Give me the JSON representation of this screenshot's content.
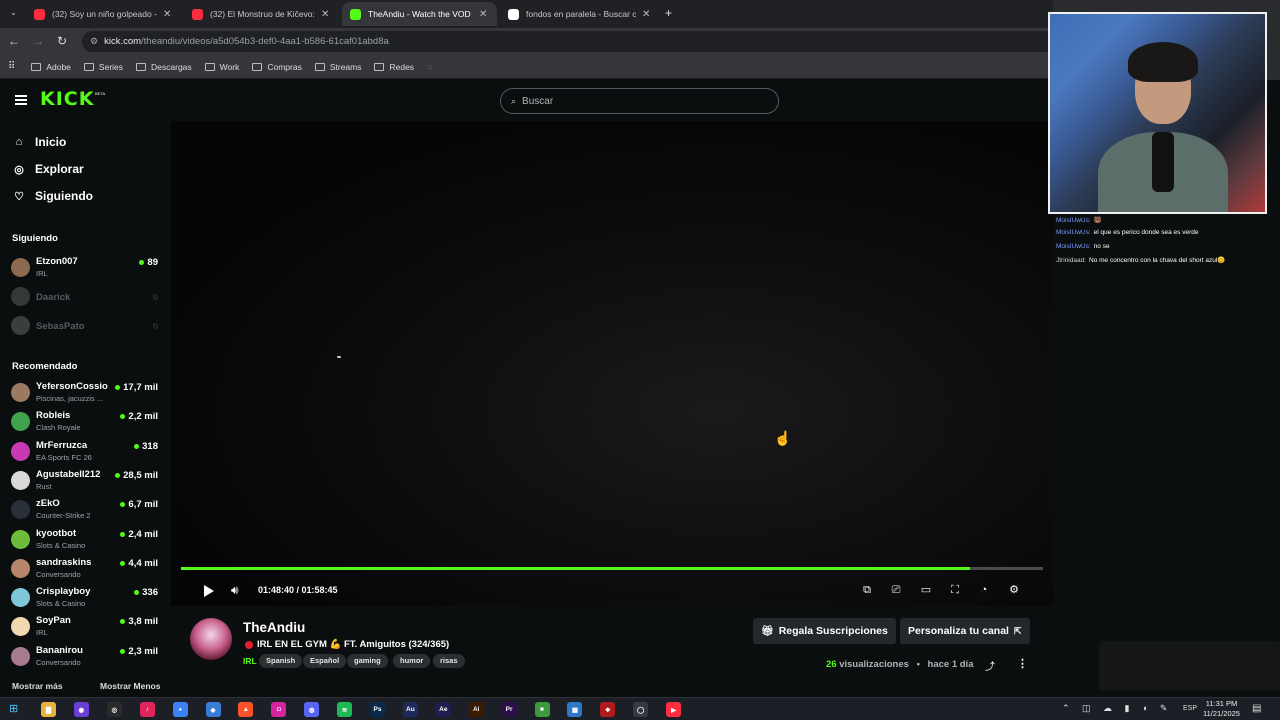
{
  "browser": {
    "tabs": [
      {
        "title": "(32) Soy un niño golpeado - Yo",
        "icon_color": "#ff2d3d",
        "active": false
      },
      {
        "title": "(32) El Monstruo de Kičevo: un",
        "icon_color": "#ff2d3d",
        "active": false
      },
      {
        "title": "TheAndiu - Watch the VOD on",
        "icon_color": "#53fc18",
        "active": true
      },
      {
        "title": "fondos en paralela - Buscar con",
        "icon_color": "#ffffff",
        "active": false
      }
    ],
    "new_tab": "+",
    "url_host": "kick.com",
    "url_path": "/theandiu/videos/a5d054b3-def0-4aa1-b586-61caf01abd8a",
    "bookmarks": [
      "Adobe",
      "Series",
      "Descargas",
      "Work",
      "Compras",
      "Streams",
      "Redes"
    ]
  },
  "kick": {
    "logo": "KICK",
    "logo_badge": "BETA",
    "search_placeholder": "Buscar"
  },
  "sidebar": {
    "nav": [
      {
        "label": "Inicio",
        "icon": "home-icon",
        "glyph": "⌂"
      },
      {
        "label": "Explorar",
        "icon": "compass-icon",
        "glyph": "◎"
      },
      {
        "label": "Siguiendo",
        "icon": "heart-icon",
        "glyph": "♡"
      }
    ],
    "following_title": "Siguiendo",
    "following": [
      {
        "name": "Etzon007",
        "sub": "IRL",
        "viewers": "89",
        "live": true,
        "color": "#8b6a4f"
      },
      {
        "name": "Daarick",
        "sub": "",
        "viewers": "",
        "live": false,
        "color": "#888"
      },
      {
        "name": "SebasPato",
        "sub": "",
        "viewers": "",
        "live": false,
        "color": "#999"
      }
    ],
    "recommended_title": "Recomendado",
    "recommended": [
      {
        "name": "YefersonCossio",
        "sub": "Piscinas, jacuzzis ...",
        "viewers": "17,7 mil",
        "color": "#9c7a62"
      },
      {
        "name": "Robleis",
        "sub": "Clash Royale",
        "viewers": "2,2 mil",
        "color": "#3fa34d"
      },
      {
        "name": "MrFerruzca",
        "sub": "EA Sports FC 26",
        "viewers": "318",
        "color": "#c83ab3"
      },
      {
        "name": "Agustabell212",
        "sub": "Rust",
        "viewers": "28,5 mil",
        "color": "#d9d9d9"
      },
      {
        "name": "zEkO",
        "sub": "Counter-Strike 2",
        "viewers": "6,7 mil",
        "color": "#2a3038"
      },
      {
        "name": "kyootbot",
        "sub": "Slots & Casino",
        "viewers": "2,4 mil",
        "color": "#6dbd3a"
      },
      {
        "name": "sandraskins",
        "sub": "Conversando",
        "viewers": "4,4 mil",
        "color": "#b7866a"
      },
      {
        "name": "Crisplayboy",
        "sub": "Slots & Casino",
        "viewers": "336",
        "color": "#7fc7d9"
      },
      {
        "name": "SoyPan",
        "sub": "IRL",
        "viewers": "3,8 mil",
        "color": "#f2d8b0"
      },
      {
        "name": "Bananirou",
        "sub": "Conversando",
        "viewers": "2,3 mil",
        "color": "#a77a8e"
      }
    ],
    "show_more": "Mostrar más",
    "show_less": "Mostrar Menos"
  },
  "player": {
    "progress": 0.915,
    "time": "01:48:40 / 01:58:45"
  },
  "stream": {
    "channel": "TheAndiu",
    "title": "IRL EN EL GYM 💪 FT. Amiguitos (324/365)",
    "category": "IRL",
    "tags": [
      "Spanish",
      "Español",
      "gaming",
      "humor",
      "risas"
    ],
    "gift_button": "Regala Suscripciones",
    "customize_button": "Personaliza tu canal",
    "views_count": "26",
    "views_label": "visualizaciones",
    "separator": "•",
    "age": "hace 1 día"
  },
  "chat": [
    {
      "user": "MoisIUwUs:",
      "text": "🐻",
      "user_style": "blue"
    },
    {
      "user": "MoisIUwUs:",
      "text": "el que es perico donde sea es verde",
      "user_style": "blue"
    },
    {
      "user": "MoisIUwUs:",
      "text": "no se",
      "user_style": "blue"
    },
    {
      "user": "Jtrinidaad:",
      "text": "No me concentro con la chava del short azul😊",
      "user_style": "gray"
    }
  ],
  "taskbar": {
    "apps": [
      {
        "name": "file-explorer",
        "label": "▇",
        "bg": "#e7b33c"
      },
      {
        "name": "app-purple",
        "label": "◉",
        "bg": "#6a3fd6"
      },
      {
        "name": "app-red-ring",
        "label": "◎",
        "bg": "#2b2b2b"
      },
      {
        "name": "tiktok",
        "label": "♪",
        "bg": "#e0245e"
      },
      {
        "name": "chrome",
        "label": "◕",
        "bg": "#3b82f6"
      },
      {
        "name": "app-cube",
        "label": "◆",
        "bg": "#3a7bd5"
      },
      {
        "name": "brave",
        "label": "▲",
        "bg": "#fb542b"
      },
      {
        "name": "instagram",
        "label": "◘",
        "bg": "#d6249f"
      },
      {
        "name": "discord",
        "label": "◍",
        "bg": "#5865f2"
      },
      {
        "name": "spotify",
        "label": "≋",
        "bg": "#1db954"
      },
      {
        "name": "photoshop",
        "label": "Ps",
        "bg": "#0b2a4a"
      },
      {
        "name": "audition",
        "label": "Au",
        "bg": "#1f2a5c"
      },
      {
        "name": "after-effects",
        "label": "Ae",
        "bg": "#1f1f4d"
      },
      {
        "name": "illustrator",
        "label": "Ai",
        "bg": "#3a1b00"
      },
      {
        "name": "premiere",
        "label": "Pr",
        "bg": "#2a0f4a"
      },
      {
        "name": "minecraft",
        "label": "■",
        "bg": "#3c9a3c"
      },
      {
        "name": "app-blue-grid",
        "label": "▦",
        "bg": "#2d78c8"
      },
      {
        "name": "app-red",
        "label": "❖",
        "bg": "#b31b1b"
      },
      {
        "name": "app-ring",
        "label": "◯",
        "bg": "#333a44"
      },
      {
        "name": "youtube-music",
        "label": "▶",
        "bg": "#ff2d3d"
      }
    ],
    "tray": "⌃ ◫ ☁ ▮ ◖ ✎",
    "lang": "ESP",
    "time": "11:31 PM",
    "date": "11/21/2025"
  }
}
